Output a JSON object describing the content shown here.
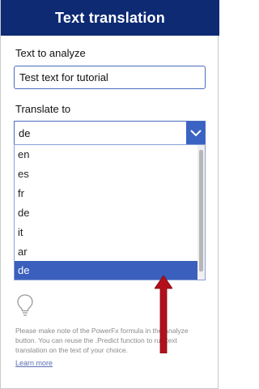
{
  "header": {
    "title": "Text translation"
  },
  "form": {
    "analyze_label": "Text to analyze",
    "analyze_value": "Test text for tutorial",
    "translate_label": "Translate to",
    "translate_selected": "de"
  },
  "dropdown": {
    "options": [
      "en",
      "es",
      "fr",
      "de",
      "it",
      "ar",
      "de"
    ],
    "highlighted_index": 6
  },
  "footer": {
    "note": "Please make note of the PowerFx formula in the Analyze button. You can reuse the .Predict function to run text translation on the text of your choice.",
    "learn_more": "Learn more"
  },
  "colors": {
    "header_bg": "#0d2a73",
    "accent": "#3b5fbd",
    "arrow": "#b3101c"
  },
  "icons": [
    "chevron-down-icon",
    "lightbulb-icon",
    "red-arrow-annotation"
  ]
}
